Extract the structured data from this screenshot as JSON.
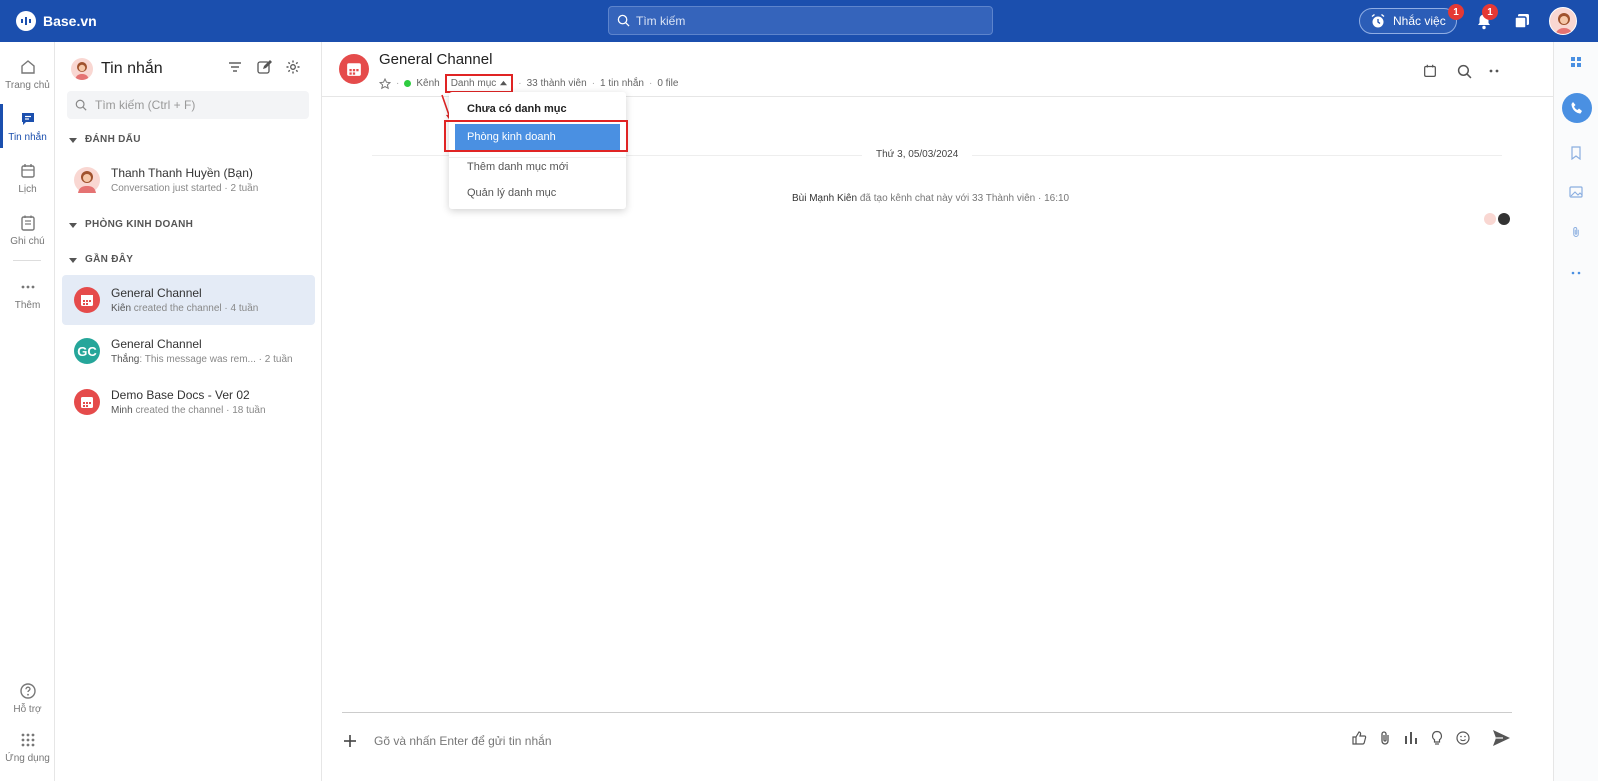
{
  "topbar": {
    "brand": "Base.vn",
    "search_placeholder": "Tìm kiếm",
    "remind_label": "Nhắc việc",
    "remind_badge": "1",
    "notify_badge": "1"
  },
  "leftnav": {
    "items": [
      {
        "label": "Trang chủ",
        "icon": "home-icon"
      },
      {
        "label": "Tin nhắn",
        "icon": "chat-icon"
      },
      {
        "label": "Lịch",
        "icon": "calendar-icon"
      },
      {
        "label": "Ghi chú",
        "icon": "note-icon"
      },
      {
        "label": "Thêm",
        "icon": "more-icon"
      },
      {
        "label": "Hỗ trợ",
        "icon": "help-icon"
      },
      {
        "label": "Ứng dụng",
        "icon": "apps-icon"
      }
    ]
  },
  "sidebar": {
    "title": "Tin nhắn",
    "search_placeholder": "Tìm kiếm (Ctrl + F)",
    "sections": {
      "starred": "ĐÁNH DẤU",
      "sales": "PHÒNG KINH DOANH",
      "recent": "GẦN ĐÂY"
    },
    "starred_conv": {
      "name": "Thanh Thanh Huyền (Bạn)",
      "sub": "Conversation just started · 2 tuần"
    },
    "recent": [
      {
        "name": "General Channel",
        "who": "Kiên",
        "sub": " created the channel · 4 tuần",
        "avatar_color": "#e54b4b"
      },
      {
        "name": "General Channel",
        "who": "Thắng",
        "sub": ": This message was rem... · 2 tuần",
        "avatar_text": "GC",
        "avatar_color": "#26a69a"
      },
      {
        "name": "Demo Base Docs - Ver 02",
        "who": "Minh",
        "sub": " created the channel · 18 tuần",
        "avatar_color": "#e54b4b"
      }
    ]
  },
  "channel": {
    "title": "General Channel",
    "type": "Kênh",
    "category_label": "Danh mục",
    "members": "33 thành viên",
    "messages": "1 tin nhắn",
    "files": "0 file"
  },
  "dropdown": {
    "header": "Chưa có danh mục",
    "selected": "Phòng kinh doanh",
    "add_new": "Thêm danh mục mới",
    "manage": "Quản lý danh mục"
  },
  "timeline": {
    "date": "Thứ 3, 05/03/2024",
    "sys_user": "Bùi Mạnh Kiên",
    "sys_text": " đã tạo kênh chat này với 33 Thành viên · 16:10"
  },
  "composer": {
    "placeholder": "Gõ và nhấn Enter để gửi tin nhắn"
  },
  "colors": {
    "brand": "#1b4fae",
    "accent": "#4a90e2",
    "channel_red": "#e54b4b",
    "highlight_red": "#e02424"
  }
}
